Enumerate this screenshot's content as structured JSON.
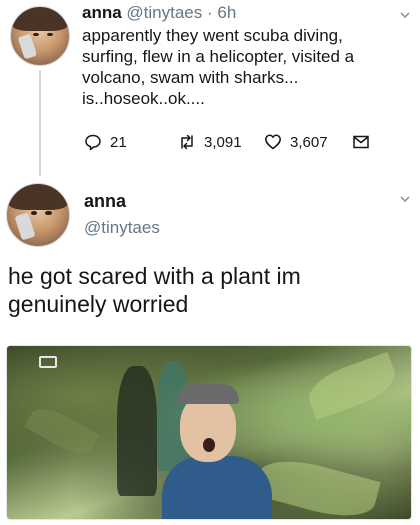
{
  "tweet1": {
    "name": "anna",
    "handle": "@tinytaes",
    "separator": " · ",
    "time": "6h",
    "lines": [
      "apparently they went scuba diving,",
      "surfing, flew in a helicopter, visited a",
      "volcano, swam with sharks...",
      "is..hoseok..ok...."
    ],
    "actions": {
      "reply_count": "21",
      "retweet_count": "3,091",
      "like_count": "3,607"
    }
  },
  "tweet2": {
    "name": "anna",
    "handle": "@tinytaes",
    "lines": [
      "he got scared with a plant im",
      "genuinely worried"
    ]
  },
  "icons": {
    "reply": "reply-icon",
    "retweet": "retweet-icon",
    "like": "heart-icon",
    "dm": "envelope-icon",
    "menu": "chevron-down-icon"
  },
  "colors": {
    "text": "#14171a",
    "secondary": "#657786",
    "thread_line": "#ccd6dd"
  }
}
